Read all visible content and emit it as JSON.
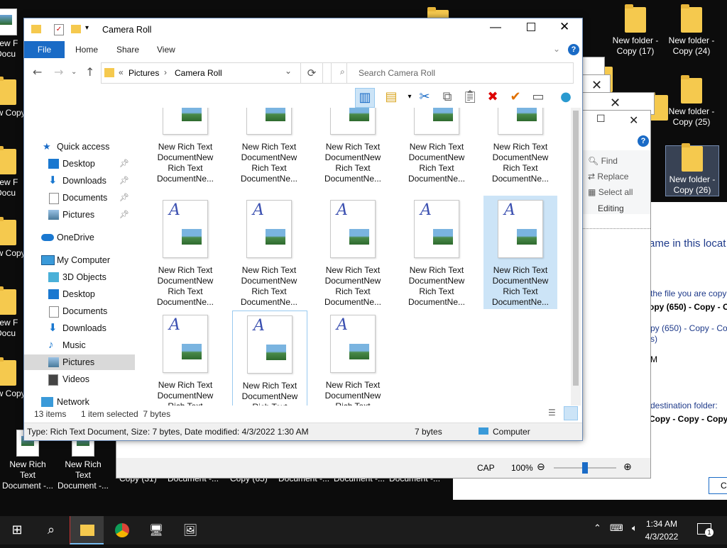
{
  "desktop": {
    "top_icons": [
      "New folder - Copy (17)",
      "New folder - Copy (24)",
      "New folder - Copy (25)",
      "New folder - Copy (26)"
    ],
    "left_icons_partial": [
      "New F Docu",
      "New Copy",
      "New F Docu",
      "New Copy",
      "New F Docu",
      "New Copy"
    ],
    "bottom_icons": [
      "New Rich Text Document -...",
      "New Rich Text Document -...",
      "Copy (31)",
      "Document -...",
      "Copy (65)",
      "Document -...",
      "Document -...",
      "Document -..."
    ]
  },
  "bg_wordpad": {
    "find": "Find",
    "replace": "Replace",
    "select_all": "Select all",
    "group": "Editing",
    "status_cap": "CAP",
    "zoom": "100%"
  },
  "bg_copy_dialog": {
    "heading": "ame in this locat",
    "line1": "the file you are copy",
    "line2": "opy (650) - Copy - Co",
    "line3": "py (650) - Copy - Cop",
    "line4": "s)",
    "line5": "M",
    "dest_label": "destination folder:",
    "dest_value": "Copy - Copy - Copy",
    "button": "C"
  },
  "explorer": {
    "title": "Camera Roll",
    "tabs": [
      "File",
      "Home",
      "Share",
      "View"
    ],
    "breadcrumb": [
      "Pictures",
      "Camera Roll"
    ],
    "breadcrumb_prefix": "«",
    "search_placeholder": "Search Camera Roll",
    "nav": {
      "quick_access": "Quick access",
      "qa_items": [
        "Desktop",
        "Downloads",
        "Documents",
        "Pictures"
      ],
      "onedrive": "OneDrive",
      "my_computer": "My Computer",
      "pc_items": [
        "3D Objects",
        "Desktop",
        "Documents",
        "Downloads",
        "Music",
        "Pictures",
        "Videos"
      ],
      "network": "Network"
    },
    "file_label_full": "New Rich Text DocumentNew Rich Text DocumentNe...",
    "file_label_short": "New Rich Text DocumentNew Rich Text",
    "status_items": "13 items",
    "status_selected": "1 item selected  7 bytes",
    "details_text": "Type: Rich Text Document, Size: 7 bytes, Date modified: 4/3/2022 1:30 AM",
    "details_size": "7 bytes",
    "details_location": "Computer"
  },
  "taskbar": {
    "time": "1:34 AM",
    "date": "4/3/2022",
    "notifications": "1"
  }
}
